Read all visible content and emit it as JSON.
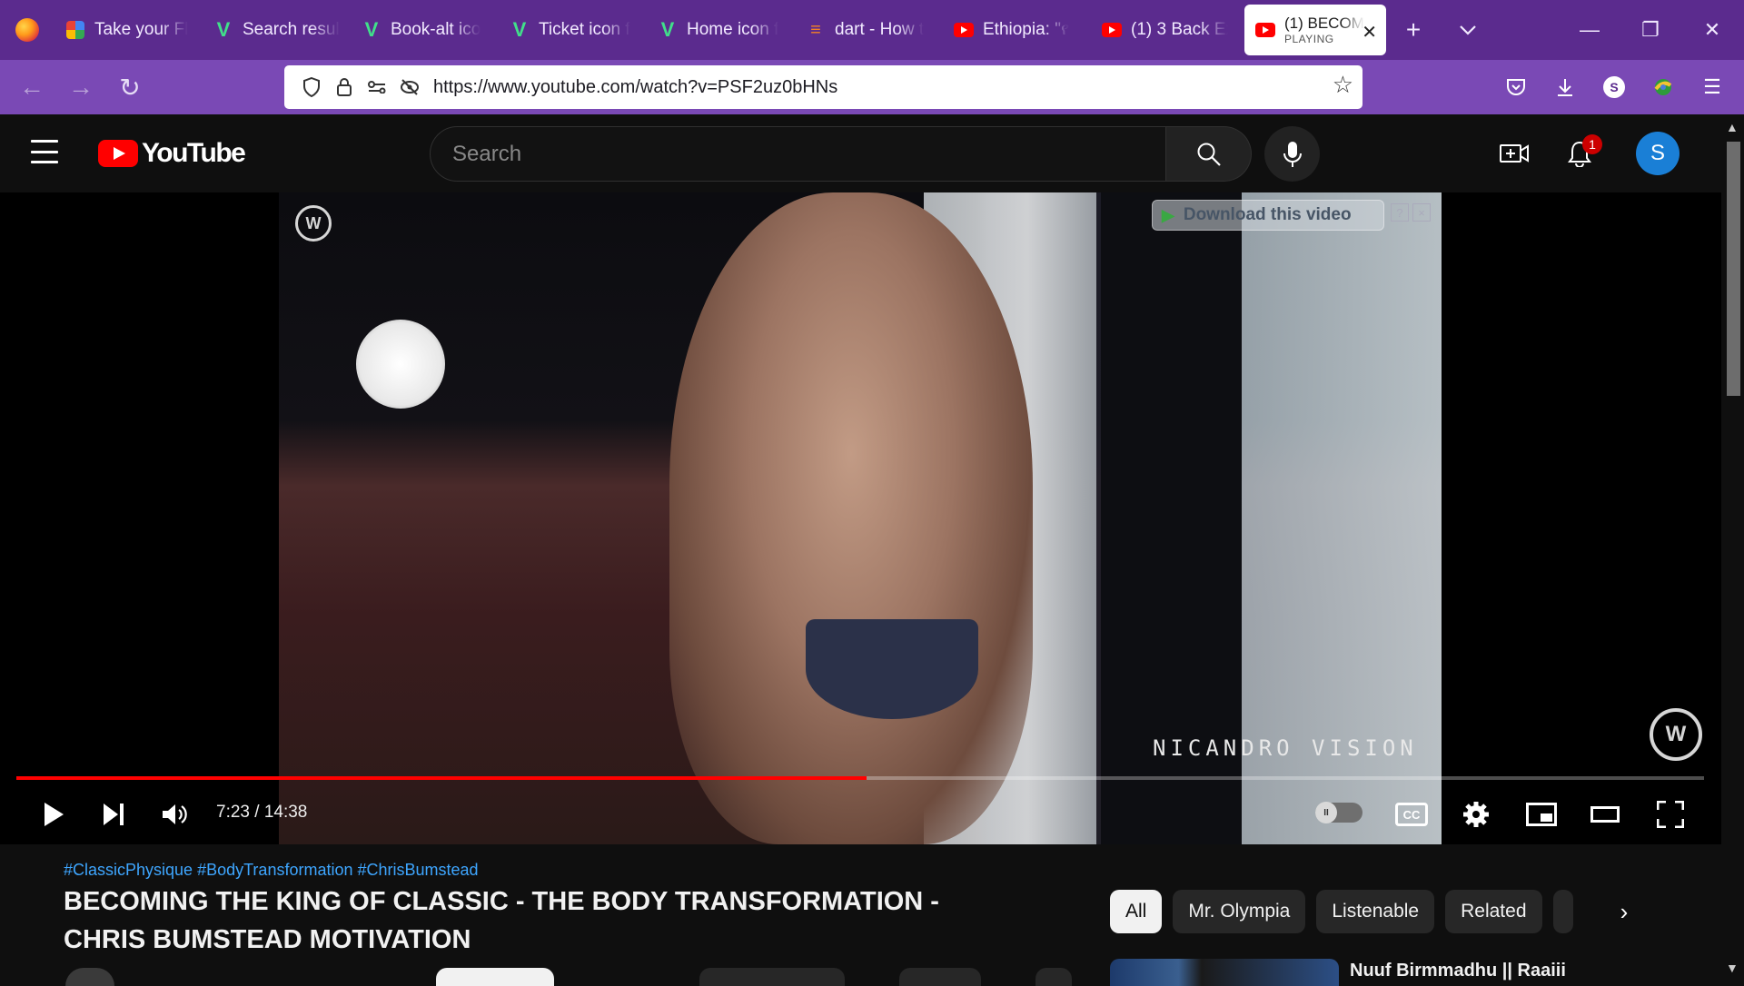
{
  "browser": {
    "tabs": [
      {
        "title": "Take your Fl",
        "favicon": "google-icon"
      },
      {
        "title": "Search resul",
        "favicon": "vue-icon"
      },
      {
        "title": "Book-alt ico",
        "favicon": "vue-icon"
      },
      {
        "title": "Ticket icon f",
        "favicon": "vue-icon"
      },
      {
        "title": "Home icon f",
        "favicon": "vue-icon"
      },
      {
        "title": "dart - How t",
        "favicon": "stackoverflow-icon"
      },
      {
        "title": "Ethiopia: \"የ",
        "favicon": "youtube-icon"
      },
      {
        "title": "(1) 3 Back Ex",
        "favicon": "youtube-icon"
      }
    ],
    "active_tab": {
      "title": "(1) BECOM",
      "status": "PLAYING",
      "favicon": "youtube-icon"
    },
    "url": "https://www.youtube.com/watch?v=PSF2uz0bHNs",
    "profile_initial": "S",
    "accent": "#5b2b8e"
  },
  "youtube": {
    "logo_text": "YouTube",
    "search_placeholder": "Search",
    "notification_count": "1",
    "avatar_initial": "S"
  },
  "player": {
    "overlay": {
      "download_label": "Download this video",
      "help": "?",
      "close": "×"
    },
    "brand_text": "NICANDRO VISION",
    "time": "7:23 / 14:38",
    "progress": 0.504,
    "autoplay": "off",
    "autoplay_glyph": "II",
    "cc_label": "CC"
  },
  "video": {
    "hashtags": "#ClassicPhysique #BodyTransformation #ChrisBumstead",
    "title": "BECOMING THE KING OF CLASSIC - THE BODY TRANSFORMATION - CHRIS BUMSTEAD MOTIVATION"
  },
  "chips": [
    "All",
    "Mr. Olympia",
    "Listenable",
    "Related"
  ],
  "recommended": {
    "title": "Nuuf Birmmadhu || Raaiii"
  }
}
